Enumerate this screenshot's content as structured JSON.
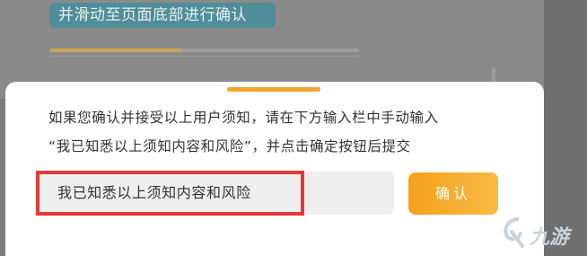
{
  "background": {
    "banner_text": "并滑动至页面底部进行确认",
    "progress_fraction": 0.43
  },
  "dialog": {
    "instruction_line1": "如果您确认并接受以上用户须知，请在下方输入栏中手动输入",
    "instruction_line2": "“我已知悉以上须知内容和风险”，并点击确定按钮后提交",
    "input_value": "我已知悉以上须知内容和风险",
    "confirm_label": "确认"
  },
  "watermark": {
    "text": "九游"
  },
  "colors": {
    "accent": "#f5a11d",
    "highlight": "#e53935",
    "overlay": "#7d7d7d"
  }
}
